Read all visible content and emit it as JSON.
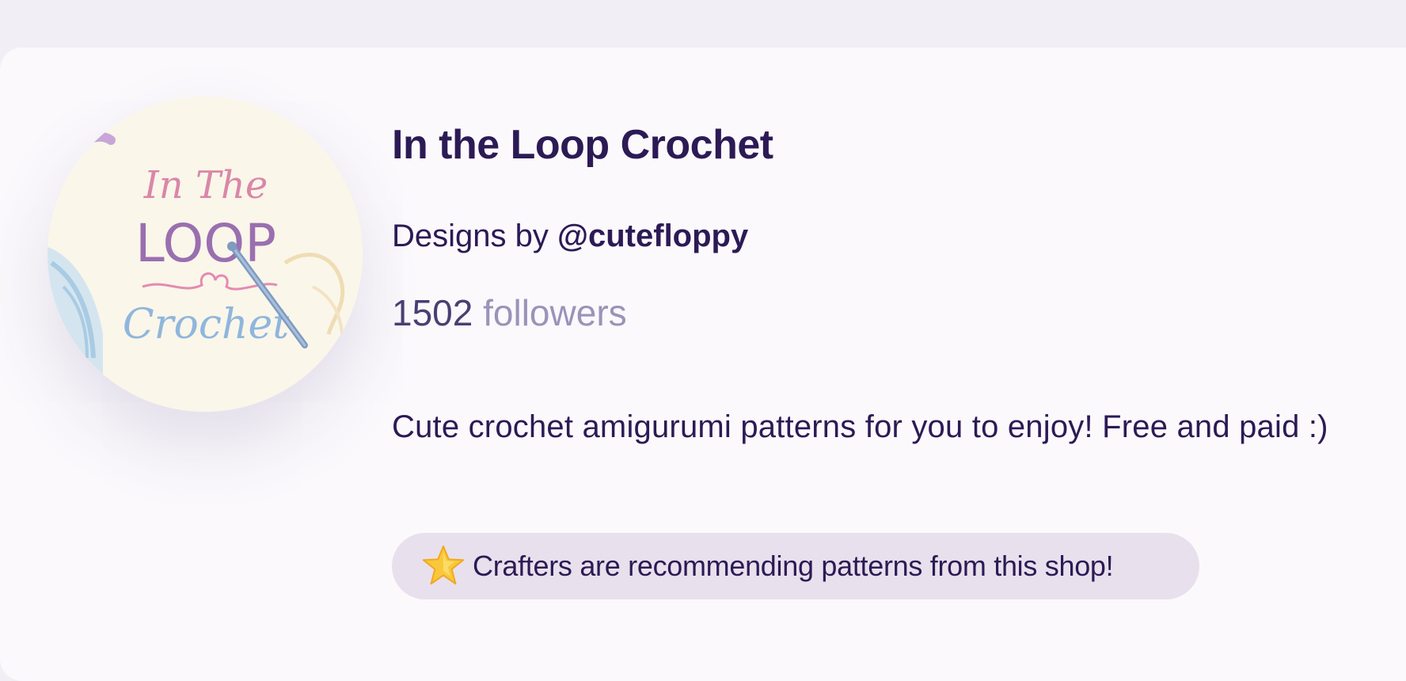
{
  "shop": {
    "name": "In the Loop Crochet",
    "logo_text": {
      "line1": "In The",
      "line2": "LOOP",
      "line3": "Crochet"
    },
    "designer_prefix": "Designs by",
    "designer_handle": "@cutefloppy",
    "followers_count": "1502",
    "followers_label": "followers",
    "description": "Cute crochet amigurumi patterns for you to enjoy! Free and paid :)",
    "recommendation": {
      "icon": "star-icon",
      "text": "Crafters are recommending patterns from this shop!"
    }
  },
  "colors": {
    "background": "#fbf9fc",
    "title": "#2c1a55",
    "muted": "#9b93b8",
    "badge": "#e8e0ec"
  }
}
